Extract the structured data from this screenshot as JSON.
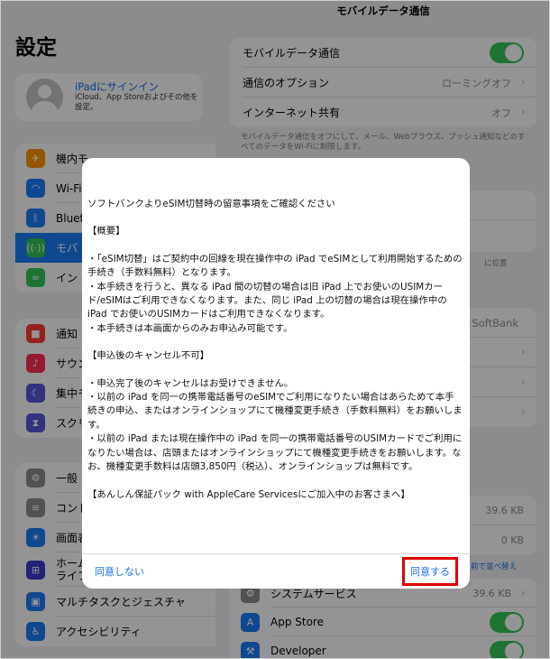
{
  "sidebar": {
    "title": "設定",
    "profile": {
      "signin": "iPadにサインイン",
      "subtitle": "iCloud、App Storeおよびその他を設定。"
    },
    "groups": [
      [
        {
          "label": "機内モ",
          "icon": "airplane-icon",
          "color": "#ff9500"
        },
        {
          "label": "Wi-Fi",
          "icon": "wifi-icon",
          "color": "#1a7cf5"
        },
        {
          "label": "Bluet",
          "icon": "bluetooth-icon",
          "color": "#1a7cf5"
        },
        {
          "label": "モバ",
          "icon": "antenna-icon",
          "color": "#34c759",
          "active": true
        },
        {
          "label": "イン",
          "icon": "link-icon",
          "color": "#34c759"
        }
      ],
      [
        {
          "label": "通知",
          "icon": "notification-icon",
          "color": "#ff3b30"
        },
        {
          "label": "サウン",
          "icon": "sound-icon",
          "color": "#ff2d55"
        },
        {
          "label": "集中モ",
          "icon": "moon-icon",
          "color": "#5856d6"
        },
        {
          "label": "スクリ",
          "icon": "hourglass-icon",
          "color": "#5856d6"
        }
      ],
      [
        {
          "label": "一般",
          "icon": "gear-icon",
          "color": "#8e8e93"
        },
        {
          "label": "コント",
          "icon": "control-center-icon",
          "color": "#8e8e93"
        },
        {
          "label": "画面表",
          "icon": "brightness-icon",
          "color": "#1a7cf5"
        },
        {
          "label": "ホーム\nライブ",
          "icon": "home-grid-icon",
          "color": "#3d3bd0"
        },
        {
          "label": "マルチタスクとジェスチャ",
          "icon": "multitask-icon",
          "color": "#1a7cf5"
        },
        {
          "label": "アクセシビリティ",
          "icon": "accessibility-icon",
          "color": "#1a7cf5"
        }
      ]
    ]
  },
  "detail": {
    "title": "モバイルデータ通信",
    "top_rows": [
      {
        "label": "モバイルデータ通信",
        "toggle": true
      },
      {
        "label": "通信のオプション",
        "value": "ローミングオフ"
      },
      {
        "label": "インターネット共有",
        "value": "オフ"
      }
    ],
    "note": "モバイルデータ通信をオフにして、メール、Webブラウズ、プッシュ通知などのすべてのデータをWi-Fiに制限します。",
    "partial_right": [
      {
        "text": "に位置"
      },
      {
        "text": "SoftBank"
      }
    ],
    "usage_values": [
      "39.6 KB",
      "0 KB"
    ],
    "sort_link": "前で並べ替え",
    "apps": [
      {
        "label": "システムサービス",
        "value": "39.6 KB",
        "icon": "gear-icon",
        "color": "#8e8e93"
      },
      {
        "label": "App Store",
        "toggle": true,
        "icon": "app-store-icon",
        "color": "#1a7cf5"
      },
      {
        "label": "Developer",
        "toggle": true,
        "icon": "developer-icon",
        "color": "#1a7cf5"
      }
    ]
  },
  "modal": {
    "paragraphs": [
      "ソフトバンクよりeSIM切替時の留意事項をご確認ください",
      "【概要】",
      "・「eSIM切替」はご契約中の回線を現在操作中の iPad でeSIMとして利用開始するための手続き（手数料無料）となります。\n・本手続きを行うと、異なる iPad 間の切替の場合は旧 iPad 上でお使いのUSIMカード/eSIMはご利用できなくなります。また、同じ iPad 上の切替の場合は現在操作中の iPad でお使いのUSIMカードはご利用できなくなります。\n・本手続きは本画面からのみお申込み可能です。",
      "【申込後のキャンセル不可】",
      "・申込完了後のキャンセルはお受けできません。\n・以前の iPad を同一の携帯電話番号のeSIMでご利用になりたい場合はあらためて本手続きの申込、またはオンラインショップにて機種変更手続き（手数料無料）をお願いします。\n・以前の iPad または現在操作中の iPad を同一の携帯電話番号のUSIMカードでご利用になりたい場合は、店頭またはオンラインショップにて機種変更手続きをお願いします。なお、機種変更手数料は店頭3,850円（税込）、オンラインショップは無料です。",
      "【あんしん保証パック with AppleCare Servicesにご加入中のお客さまへ】"
    ],
    "decline_label": "同意しない",
    "agree_label": "同意する",
    "highlight_color": "#e00000"
  }
}
